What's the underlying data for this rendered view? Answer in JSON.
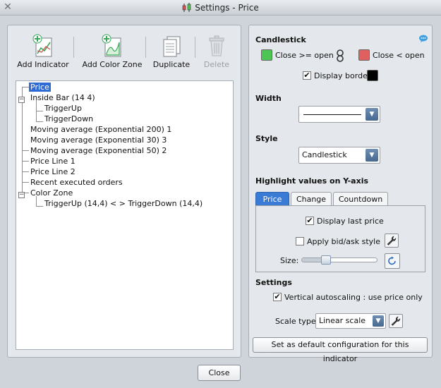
{
  "window": {
    "title": "Settings - Price"
  },
  "toolbar": {
    "add_indicator": "Add Indicator",
    "add_color_zone": "Add Color Zone",
    "duplicate": "Duplicate",
    "delete": "Delete"
  },
  "tree": {
    "items": [
      "Price",
      "Inside Bar (14 4)",
      "TriggerUp",
      "TriggerDown",
      "Moving average (Exponential 200) 1",
      "Moving average (Exponential 30) 3",
      "Moving average (Exponential 50) 2",
      "Price Line 1",
      "Price Line 2",
      "Recent executed orders",
      "Color Zone",
      "TriggerUp (14,4) < > TriggerDown (14,4)"
    ],
    "selected": "Price"
  },
  "candlestick": {
    "section_title": "Candlestick",
    "close_up_label": "Close >= open",
    "close_down_label": "Close < open",
    "display_border_label": "Display border",
    "display_border_checked": true,
    "up_color": "#4cc552",
    "down_color": "#e06060",
    "border_color": "#000000"
  },
  "width": {
    "section_title": "Width"
  },
  "style": {
    "section_title": "Style",
    "selected": "Candlestick"
  },
  "highlight": {
    "section_title": "Highlight values on Y-axis",
    "tabs": [
      "Price",
      "Change",
      "Countdown"
    ],
    "active_tab": "Price",
    "display_last_price_label": "Display last price",
    "display_last_price_checked": true,
    "apply_bid_ask_label": "Apply bid/ask style",
    "apply_bid_ask_checked": false,
    "size_label": "Size:",
    "size_value": 0.3
  },
  "settings": {
    "section_title": "Settings",
    "vertical_autoscaling_label": "Vertical autoscaling : use price only",
    "vertical_autoscaling_checked": true,
    "scale_type_label": "Scale type",
    "scale_type_value": "Linear scale",
    "default_button": "Set as default configuration for this indicator"
  },
  "footer": {
    "close_button": "Close"
  },
  "colors": {
    "accent": "#3a7bd5",
    "selection": "#2f6bd6"
  }
}
